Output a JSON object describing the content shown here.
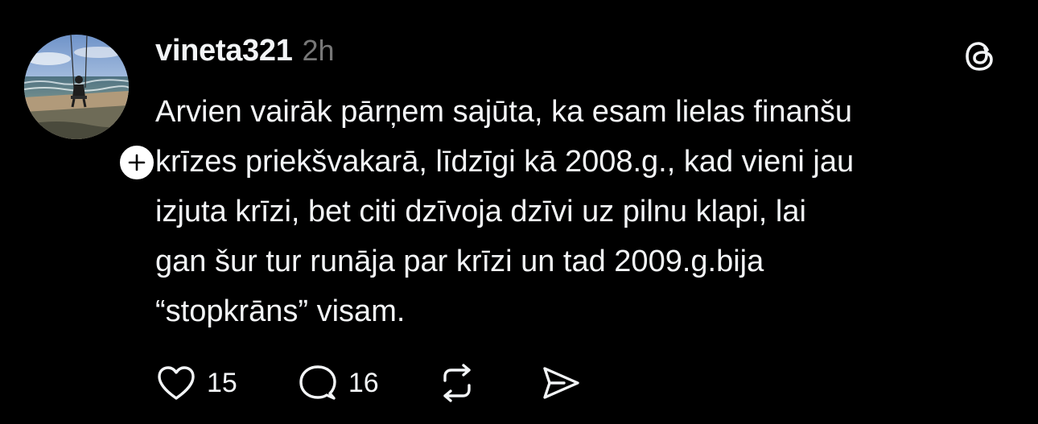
{
  "post": {
    "username": "vineta321",
    "timestamp": "2h",
    "text_lines": [
      "Arvien vairāk pārņem sajūta, ka esam lielas finanšu",
      "krīzes priekšvakarā, līdzīgi kā 2008.g., kad vieni jau",
      "izjuta krīzi, bet citi dzīvoja dzīvi uz pilnu klapi, lai",
      "gan šur tur runāja par krīzi un tad 2009.g.bija",
      "“stopkrāns” visam."
    ],
    "likes": "15",
    "replies": "16"
  },
  "icons": {
    "avatar": "beach-swing-photo",
    "follow": "plus-icon",
    "brand": "threads-logo-icon",
    "like": "heart-icon",
    "reply": "comment-bubble-icon",
    "repost": "repost-icon",
    "share": "send-icon"
  },
  "colors": {
    "background": "#000000",
    "text": "#f3f5f7",
    "muted": "#777777"
  }
}
